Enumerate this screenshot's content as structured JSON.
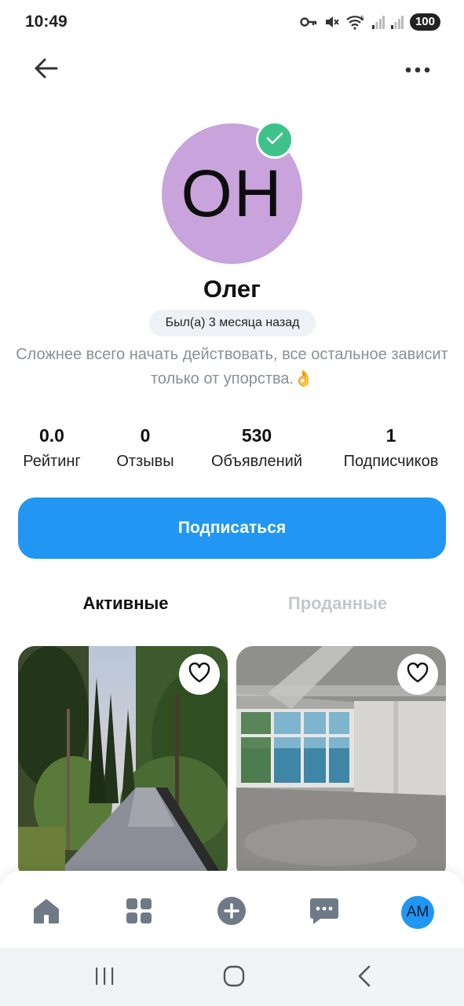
{
  "status_bar": {
    "time": "10:49",
    "battery": "100",
    "icons": [
      "key-icon",
      "mute-icon",
      "wifi-icon",
      "signal-icon",
      "signal-icon"
    ]
  },
  "top_bar": {
    "back_icon": "arrow-left-icon",
    "menu_icon": "more-horizontal-icon"
  },
  "profile": {
    "initials": "ОН",
    "avatar_color": "#c9a3dc",
    "verified_color": "#3ec28a",
    "name": "Олег",
    "last_seen": "Был(а) 3 месяца назад",
    "bio": "Сложнее всего начать действовать, все остальное зависит только от упорства.👌"
  },
  "stats": [
    {
      "value": "0.0",
      "label": "Рейтинг"
    },
    {
      "value": "0",
      "label": "Отзывы"
    },
    {
      "value": "530",
      "label": "Объявлений"
    },
    {
      "value": "1",
      "label": "Подписчиков"
    }
  ],
  "subscribe_button": {
    "label": "Подписаться",
    "color": "#2196f3"
  },
  "tabs": [
    {
      "label": "Активные",
      "active": true
    },
    {
      "label": "Проданные",
      "active": false
    }
  ],
  "listings": [
    {
      "photo": "alley-with-trees",
      "favorite_icon": "heart-outline-icon"
    },
    {
      "photo": "empty-room-with-sea-view",
      "favorite_icon": "heart-outline-icon"
    }
  ],
  "bottom_nav": {
    "items": [
      "home-icon",
      "grid-icon",
      "plus-circle-icon",
      "chat-icon"
    ],
    "avatar_initials": "AM"
  },
  "system_nav": [
    "recent-apps-icon",
    "home-circle-icon",
    "back-chevron-icon"
  ]
}
